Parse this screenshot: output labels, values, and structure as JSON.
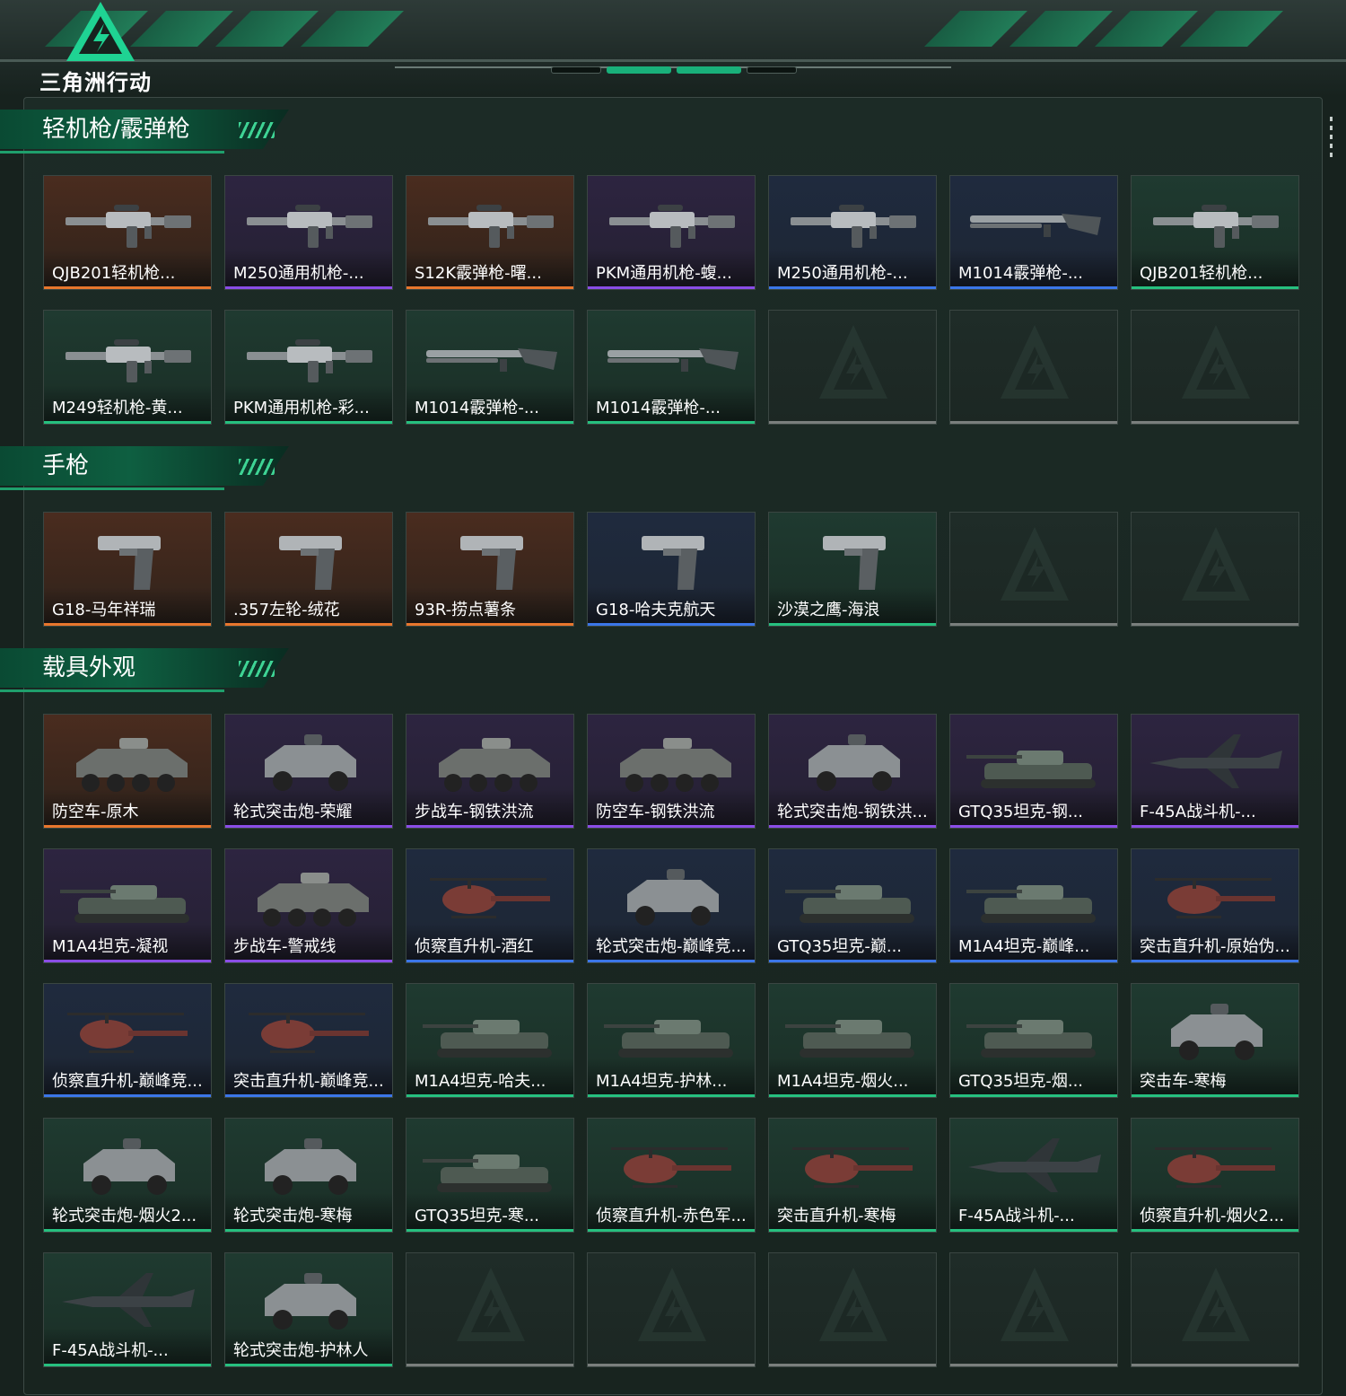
{
  "app": {
    "logo_text": "三角洲行动"
  },
  "colors": {
    "orange": "#e8762d",
    "purple": "#8a4de6",
    "blue": "#3b76e8",
    "green": "#26c07f",
    "brand": "#19b07a"
  },
  "sections": [
    {
      "title": "轻机枪/霰弹枪",
      "items": [
        {
          "label": "QJB201轻机枪...",
          "rarity": "orange",
          "icon": "rifle"
        },
        {
          "label": "M250通用机枪-...",
          "rarity": "purple",
          "icon": "rifle"
        },
        {
          "label": "S12K霰弹枪-曙...",
          "rarity": "orange",
          "icon": "rifle"
        },
        {
          "label": "PKM通用机枪-蝮...",
          "rarity": "purple",
          "icon": "rifle"
        },
        {
          "label": "M250通用机枪-...",
          "rarity": "blue",
          "icon": "rifle"
        },
        {
          "label": "M1014霰弹枪-...",
          "rarity": "blue",
          "icon": "shotgun"
        },
        {
          "label": "QJB201轻机枪...",
          "rarity": "green",
          "icon": "rifle"
        },
        {
          "label": "M249轻机枪-黄...",
          "rarity": "green",
          "icon": "rifle"
        },
        {
          "label": "PKM通用机枪-彩...",
          "rarity": "green",
          "icon": "rifle"
        },
        {
          "label": "M1014霰弹枪-...",
          "rarity": "green",
          "icon": "shotgun"
        },
        {
          "label": "M1014霰弹枪-...",
          "rarity": "green",
          "icon": "shotgun"
        },
        {
          "label": "",
          "rarity": "empty",
          "icon": "emblem"
        },
        {
          "label": "",
          "rarity": "empty",
          "icon": "emblem"
        },
        {
          "label": "",
          "rarity": "empty",
          "icon": "emblem"
        }
      ]
    },
    {
      "title": "手枪",
      "items": [
        {
          "label": "G18-马年祥瑞",
          "rarity": "orange",
          "icon": "pistol"
        },
        {
          "label": ".357左轮-绒花",
          "rarity": "orange",
          "icon": "pistol"
        },
        {
          "label": "93R-捞点薯条",
          "rarity": "orange",
          "icon": "pistol"
        },
        {
          "label": "G18-哈夫克航天",
          "rarity": "blue",
          "icon": "pistol"
        },
        {
          "label": "沙漠之鹰-海浪",
          "rarity": "green",
          "icon": "pistol"
        },
        {
          "label": "",
          "rarity": "empty",
          "icon": "emblem"
        },
        {
          "label": "",
          "rarity": "empty",
          "icon": "emblem"
        }
      ]
    },
    {
      "title": "载具外观",
      "items": [
        {
          "label": "防空车-原木",
          "rarity": "orange",
          "icon": "apc"
        },
        {
          "label": "轮式突击炮-荣耀",
          "rarity": "purple",
          "icon": "truck"
        },
        {
          "label": "步战车-钢铁洪流",
          "rarity": "purple",
          "icon": "apc"
        },
        {
          "label": "防空车-钢铁洪流",
          "rarity": "purple",
          "icon": "apc"
        },
        {
          "label": "轮式突击炮-钢铁洪...",
          "rarity": "purple",
          "icon": "truck"
        },
        {
          "label": "GTQ35坦克-钢...",
          "rarity": "purple",
          "icon": "tank"
        },
        {
          "label": "F-45A战斗机-...",
          "rarity": "purple",
          "icon": "jet"
        },
        {
          "label": "M1A4坦克-凝视",
          "rarity": "purple",
          "icon": "tank"
        },
        {
          "label": "步战车-警戒线",
          "rarity": "purple",
          "icon": "apc"
        },
        {
          "label": "侦察直升机-酒红",
          "rarity": "blue",
          "icon": "heli"
        },
        {
          "label": "轮式突击炮-巅峰竞...",
          "rarity": "blue",
          "icon": "truck"
        },
        {
          "label": "GTQ35坦克-巅...",
          "rarity": "blue",
          "icon": "tank"
        },
        {
          "label": "M1A4坦克-巅峰...",
          "rarity": "blue",
          "icon": "tank"
        },
        {
          "label": "突击直升机-原始伪...",
          "rarity": "blue",
          "icon": "heli"
        },
        {
          "label": "侦察直升机-巅峰竞...",
          "rarity": "blue",
          "icon": "heli"
        },
        {
          "label": "突击直升机-巅峰竞...",
          "rarity": "blue",
          "icon": "heli"
        },
        {
          "label": "M1A4坦克-哈夫...",
          "rarity": "green",
          "icon": "tank"
        },
        {
          "label": "M1A4坦克-护林...",
          "rarity": "green",
          "icon": "tank"
        },
        {
          "label": "M1A4坦克-烟火...",
          "rarity": "green",
          "icon": "tank"
        },
        {
          "label": "GTQ35坦克-烟...",
          "rarity": "green",
          "icon": "tank"
        },
        {
          "label": "突击车-寒梅",
          "rarity": "green",
          "icon": "truck"
        },
        {
          "label": "轮式突击炮-烟火2...",
          "rarity": "green",
          "icon": "truck"
        },
        {
          "label": "轮式突击炮-寒梅",
          "rarity": "green",
          "icon": "truck"
        },
        {
          "label": "GTQ35坦克-寒...",
          "rarity": "green",
          "icon": "tank"
        },
        {
          "label": "侦察直升机-赤色军...",
          "rarity": "green",
          "icon": "heli"
        },
        {
          "label": "突击直升机-寒梅",
          "rarity": "green",
          "icon": "heli"
        },
        {
          "label": "F-45A战斗机-...",
          "rarity": "green",
          "icon": "jet"
        },
        {
          "label": "侦察直升机-烟火2...",
          "rarity": "green",
          "icon": "heli"
        },
        {
          "label": "F-45A战斗机-...",
          "rarity": "green",
          "icon": "jet"
        },
        {
          "label": "轮式突击炮-护林人",
          "rarity": "green",
          "icon": "truck"
        },
        {
          "label": "",
          "rarity": "empty",
          "icon": "emblem"
        },
        {
          "label": "",
          "rarity": "empty",
          "icon": "emblem"
        },
        {
          "label": "",
          "rarity": "empty",
          "icon": "emblem"
        },
        {
          "label": "",
          "rarity": "empty",
          "icon": "emblem"
        },
        {
          "label": "",
          "rarity": "empty",
          "icon": "emblem"
        }
      ]
    }
  ]
}
